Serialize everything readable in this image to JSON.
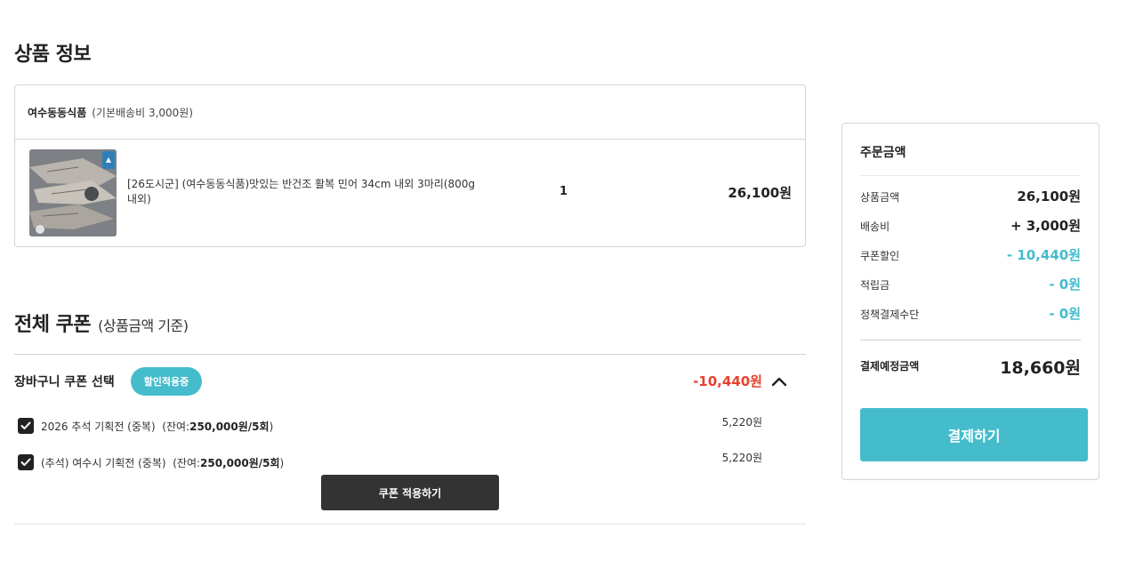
{
  "product_section": {
    "title": "상품 정보",
    "seller": {
      "name": "여수동동식품",
      "shipping_note": "(기본배송비 3,000원)"
    },
    "item": {
      "name": "[26도시군] (여수동동식품)맛있는 반건조 활복 민어 34cm 내외 3마리(800g내외)",
      "quantity": "1",
      "price": "26,100원"
    }
  },
  "coupon_section": {
    "title": "전체 쿠폰",
    "subtitle": "(상품금액 기준)",
    "cart_coupon_label": "장바구니 쿠폰 선택",
    "badge": "할인적용중",
    "total_discount": "-10,440원",
    "coupons": [
      {
        "name": "2026 추석 기획전 (중복)",
        "remain_prefix": "(잔여:",
        "remain_value": "250,000원/5회",
        "remain_suffix": ")",
        "amount": "5,220원",
        "checked": true
      },
      {
        "name": "(추석) 여수시 기획전 (중복)",
        "remain_prefix": "(잔여:",
        "remain_value": "250,000원/5회",
        "remain_suffix": ")",
        "amount": "5,220원",
        "checked": true
      }
    ],
    "apply_button": "쿠폰 적용하기"
  },
  "summary": {
    "title": "주문금액",
    "rows": [
      {
        "label": "상품금액",
        "value": "26,100원"
      },
      {
        "label": "배송비",
        "value": "+ 3,000원"
      },
      {
        "label": "쿠폰할인",
        "value": "- 10,440원"
      },
      {
        "label": "적립금",
        "value": "- 0원"
      },
      {
        "label": "정책결제수단",
        "value": "- 0원"
      }
    ],
    "final_label": "결제예정금액",
    "final_value": "18,660원",
    "pay_button": "결제하기"
  },
  "colors": {
    "accent": "#44bccc",
    "discount_red": "#e8402f",
    "dark_button": "#333333"
  },
  "icons": {
    "toggle": "chevron-up-icon",
    "checkbox": "check-icon"
  }
}
